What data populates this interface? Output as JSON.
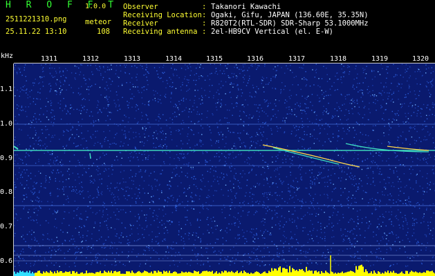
{
  "header": {
    "brand": "H R O F F T",
    "version": "1.0.0",
    "filename": "2511221310.png",
    "event_type": "meteor",
    "datetime": "25.11.22 13:10",
    "count": "108"
  },
  "meta": [
    {
      "key": "Observer",
      "value": "Takanori Kawachi"
    },
    {
      "key": "Receiving Location",
      "value": "Ogaki, Gifu, JAPAN (136.60E, 35.35N)"
    },
    {
      "key": "Receiver",
      "value": "R820T2(RTL-SDR) SDR-Sharp 53.1000MHz"
    },
    {
      "key": "Receiving antenna",
      "value": "2el-HB9CV Vertical (el. E-W)"
    }
  ],
  "separator": ":",
  "axis": {
    "y_unit": "kHz",
    "y_ticks": [
      "1.1",
      "1.0",
      "0.9",
      "0.8",
      "0.7",
      "0.6"
    ],
    "x_ticks": [
      "1311",
      "1312",
      "1313",
      "1314",
      "1315",
      "1316",
      "1317",
      "1318",
      "1319",
      "1320"
    ]
  },
  "colors": {
    "background": "#0a1a6e",
    "noise": "#2a5bd6",
    "carrier": "#3fe0c0",
    "trail": "#ffd84a",
    "baseline": "#ffff00",
    "text_yellow": "#ffff33",
    "text_green": "#33ff33"
  }
}
